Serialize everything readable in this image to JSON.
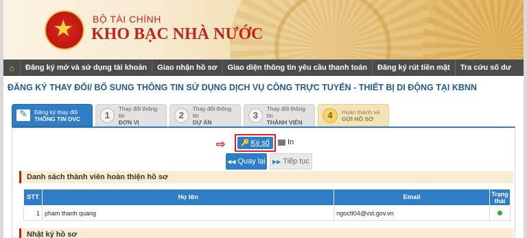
{
  "header": {
    "org_top": "BỘ TÀI CHÍNH",
    "org_main": "KHO BẠC NHÀ NƯỚC"
  },
  "nav": {
    "home_icon": "home-icon",
    "items": [
      "Đăng ký mở và sử dụng tài khoản",
      "Giao nhận hồ sơ",
      "Giao diện thông tin yêu cầu thanh toán",
      "Đăng ký rút tiền mặt",
      "Tra cứu số dư"
    ]
  },
  "page_title": "ĐĂNG KÝ THAY ĐỔI/ BỔ SUNG THÔNG TIN SỬ DỤNG DỊCH VỤ CÔNG TRỰC TUYẾN - THIẾT BỊ DI ĐỘNG TẠI KBNN",
  "steps": [
    {
      "line1": "Đăng ký thay đổi",
      "line2": "THÔNG TIN DVC"
    },
    {
      "num": "1",
      "line1": "Thay đổi thông tin",
      "line2": "ĐƠN VỊ"
    },
    {
      "num": "2",
      "line1": "Thay đổi thông tin",
      "line2": "DỰ ÁN"
    },
    {
      "num": "3",
      "line1": "Thay đổi thông tin",
      "line2": "THÀNH VIÊN"
    },
    {
      "num": "4",
      "line1": "Hoàn thành và",
      "line2": "GỬI HỒ SƠ"
    }
  ],
  "actions": {
    "sign": "Ký số",
    "print": "In",
    "back": "Quay lại",
    "next": "Tiếp tục"
  },
  "members_section": {
    "title": "Danh sách thành viên hoàn thiện hồ sơ",
    "columns": [
      "STT",
      "Họ tên",
      "Email",
      "Trạng thái"
    ],
    "rows": [
      {
        "stt": "1",
        "name": "pham thanh quang",
        "email": "ngoctt04@vst.gov.vn",
        "status": "active"
      }
    ]
  },
  "log_section": {
    "title": "Nhật ký hồ sơ"
  },
  "colors": {
    "accent": "#2f7dc6",
    "brand_red": "#c2231c",
    "nav_bg": "#4b4b4b",
    "title_blue": "#215a93",
    "status_ok": "#2cb12f"
  }
}
